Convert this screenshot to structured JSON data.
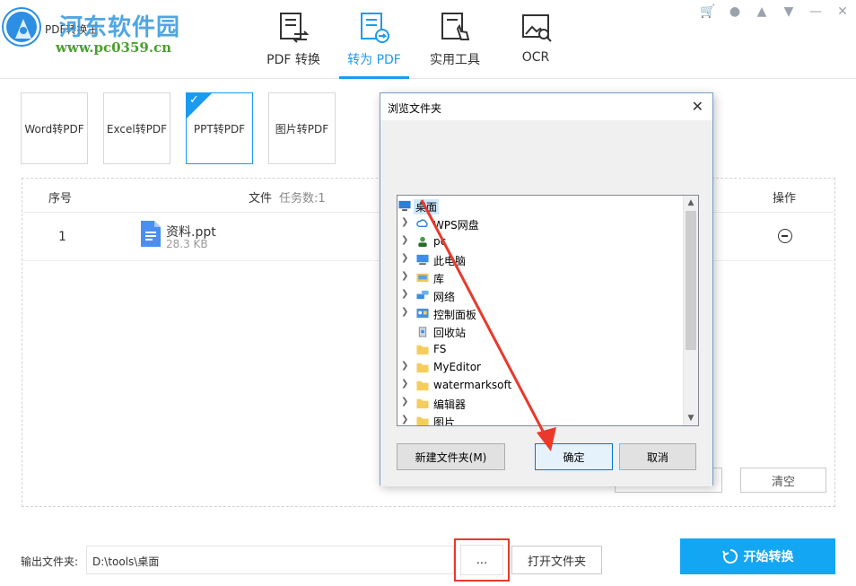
{
  "app": {
    "title": "PDF转换王",
    "watermark": "河东软件园",
    "watermark_url": "www.pc0359.cn"
  },
  "nav": {
    "tabs": [
      {
        "label": "PDF 转换",
        "active": false
      },
      {
        "label": "转为 PDF",
        "active": true
      },
      {
        "label": "实用工具",
        "active": false
      },
      {
        "label": "OCR",
        "active": false
      }
    ]
  },
  "win_controls": [
    "cart-icon",
    "user-icon",
    "bell-icon",
    "menu-icon",
    "minimize-icon",
    "close-icon"
  ],
  "types": [
    {
      "label": "Word转PDF",
      "active": false
    },
    {
      "label": "Excel转PDF",
      "active": false
    },
    {
      "label": "PPT转PDF",
      "active": true
    },
    {
      "label": "图片转PDF",
      "active": false
    }
  ],
  "table": {
    "col_no": "序号",
    "col_file": "文件",
    "col_task": "任务数:1",
    "col_op": "操作",
    "rows": [
      {
        "no": "1",
        "name": "资料.ppt",
        "size": "28.3 KB"
      }
    ],
    "clear_label": "清空"
  },
  "output": {
    "label": "输出文件夹:",
    "path": "D:\\tools\\桌面",
    "browse_label": "...",
    "open_folder_label": "打开文件夹",
    "start_label": "开始转换"
  },
  "dialog": {
    "title": "浏览文件夹",
    "close": "✕",
    "items": [
      {
        "label": "桌面",
        "icon": "desktop-icon",
        "expandable": false,
        "selected": true,
        "indent": 0
      },
      {
        "label": "WPS网盘",
        "icon": "cloud-icon",
        "expandable": true,
        "selected": false,
        "indent": 1
      },
      {
        "label": "pc",
        "icon": "user-icon",
        "expandable": true,
        "selected": false,
        "indent": 1
      },
      {
        "label": "此电脑",
        "icon": "computer-icon",
        "expandable": true,
        "selected": false,
        "indent": 1
      },
      {
        "label": "库",
        "icon": "library-icon",
        "expandable": true,
        "selected": false,
        "indent": 1
      },
      {
        "label": "网络",
        "icon": "network-icon",
        "expandable": true,
        "selected": false,
        "indent": 1
      },
      {
        "label": "控制面板",
        "icon": "control-panel-icon",
        "expandable": true,
        "selected": false,
        "indent": 1
      },
      {
        "label": "回收站",
        "icon": "recycle-bin-icon",
        "expandable": false,
        "selected": false,
        "indent": 1
      },
      {
        "label": "FS",
        "icon": "folder-icon",
        "expandable": false,
        "selected": false,
        "indent": 1
      },
      {
        "label": "MyEditor",
        "icon": "folder-icon",
        "expandable": true,
        "selected": false,
        "indent": 1
      },
      {
        "label": "watermarksoft",
        "icon": "folder-icon",
        "expandable": true,
        "selected": false,
        "indent": 1
      },
      {
        "label": "编辑器",
        "icon": "folder-icon",
        "expandable": true,
        "selected": false,
        "indent": 1
      },
      {
        "label": "图片",
        "icon": "folder-icon",
        "expandable": true,
        "selected": false,
        "indent": 1
      }
    ],
    "new_folder_label": "新建文件夹(M)",
    "ok_label": "确定",
    "cancel_label": "取消"
  },
  "colors": {
    "accent": "#1a9bf0",
    "start_button": "#13a6f3",
    "highlight_red": "#e8392c"
  }
}
